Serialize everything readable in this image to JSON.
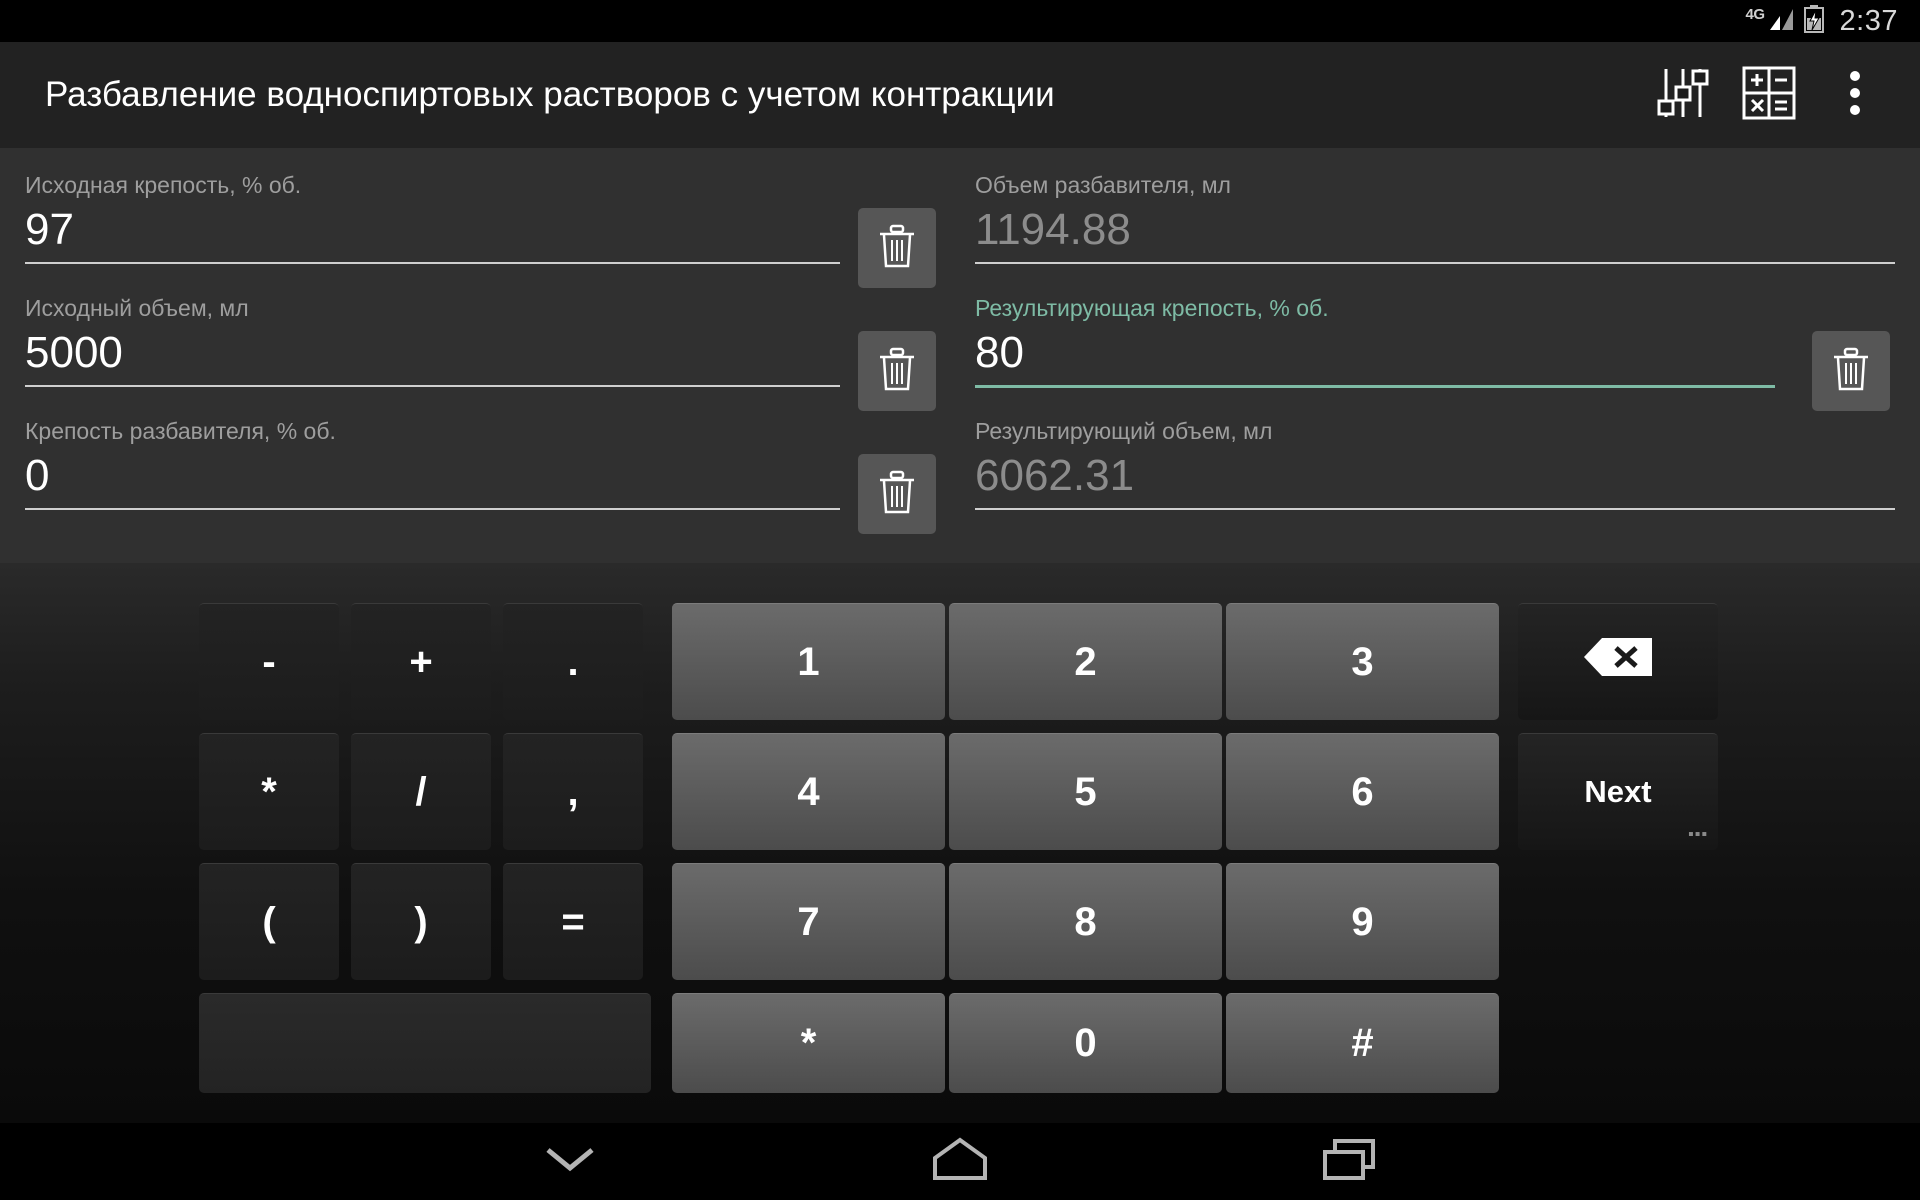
{
  "status_bar": {
    "network": "4G",
    "clock": "2:37",
    "icons": [
      "signal-icon",
      "battery-charging-icon"
    ]
  },
  "action_bar": {
    "title": "Разбавление водноспиртовых растворов с учетом контракции",
    "icons": [
      {
        "name": "sliders-icon",
        "label": "Settings sliders"
      },
      {
        "name": "calculator-icon",
        "label": "Calculator"
      },
      {
        "name": "overflow-menu-icon",
        "label": "More options"
      }
    ]
  },
  "form": {
    "accent_color": "#7ebba5",
    "left_fields": [
      {
        "label": "Исходная крепость, % об.",
        "value": "97",
        "state": "filled"
      },
      {
        "label": "Исходный объем, мл",
        "value": "5000",
        "state": "filled"
      },
      {
        "label": "Крепость разбавителя, % об.",
        "value": "0",
        "state": "filled"
      }
    ],
    "right_fields": [
      {
        "label": "Объем разбавителя, мл",
        "value": "1194.88",
        "state": "computed"
      },
      {
        "label": "Результирующая крепость, % об.",
        "value": "80",
        "state": "focused"
      },
      {
        "label": "Результирующий объем, мл",
        "value": "6062.31",
        "state": "computed"
      }
    ],
    "clear_buttons": [
      {
        "name": "clear-initial-strength",
        "icon": "trash-icon"
      },
      {
        "name": "clear-initial-volume",
        "icon": "trash-icon"
      },
      {
        "name": "clear-diluent-strength",
        "icon": "trash-icon"
      },
      {
        "name": "clear-result-strength",
        "icon": "trash-icon"
      }
    ]
  },
  "keyboard": {
    "operator_keys": [
      "-",
      "+",
      ".",
      "*",
      "/",
      ",",
      "(",
      ")",
      "="
    ],
    "number_rows": [
      [
        "1",
        "2",
        "3"
      ],
      [
        "4",
        "5",
        "6"
      ],
      [
        "7",
        "8",
        "9"
      ],
      [
        "*",
        "0",
        "#"
      ]
    ],
    "backspace_label": "",
    "next_label": "Next",
    "next_hint": "▪▪▪",
    "blank_key_label": ""
  },
  "nav_bar": {
    "buttons": [
      {
        "name": "hide-keyboard-icon",
        "label": "Hide keyboard"
      },
      {
        "name": "home-icon",
        "label": "Home"
      },
      {
        "name": "recents-icon",
        "label": "Recents"
      }
    ]
  }
}
